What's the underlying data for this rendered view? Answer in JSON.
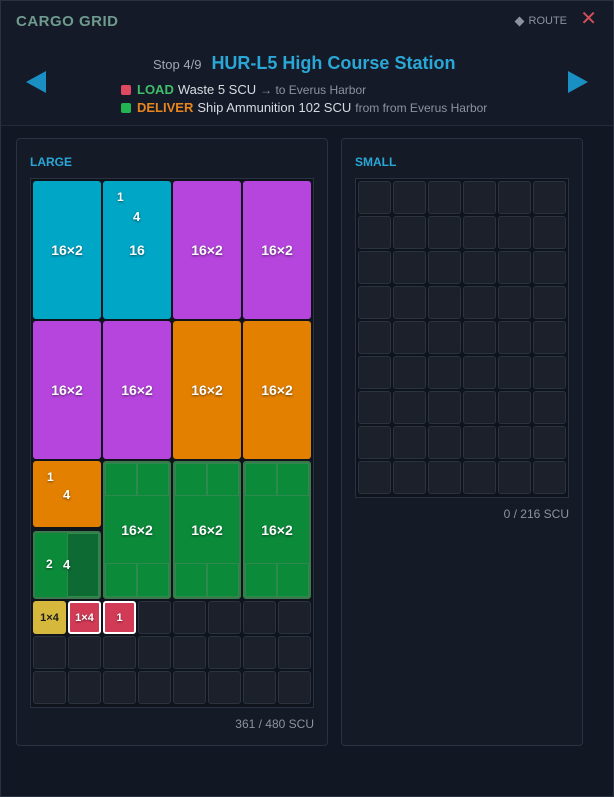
{
  "header": {
    "title": "CARGO GRID",
    "route_label": "ROUTE",
    "close_symbol": "✕",
    "stop_label": "Stop 4/9",
    "station_name": "HUR-L5 High Course Station"
  },
  "tasks": {
    "load": {
      "keyword": "LOAD",
      "cargo": "Waste 5 SCU",
      "dest": "→ to Everus Harbor",
      "color": "#e04a60"
    },
    "deliver": {
      "keyword": "DELIVER",
      "cargo": "Ship Ammunition 102 SCU",
      "dest": "from from Everus Harbor",
      "color": "#23b452"
    }
  },
  "large": {
    "title": "LARGE",
    "capacity": "361 / 480 SCU",
    "blocks": {
      "b1": "16×2",
      "b2_top": "1",
      "b2_mid": "4",
      "b2_main": "16",
      "b3": "16×2",
      "b4": "16×2",
      "b5": "16×2",
      "b6": "16×2",
      "b7": "16×2",
      "b8": "16×2",
      "b9_top": "1",
      "b9_mid": "4",
      "b10": "16×2",
      "b11": "16×2",
      "b12": "16×2",
      "b13_a": "2",
      "b13_b": "4",
      "s1": "1×4",
      "s2": "1×4",
      "s3": "1"
    }
  },
  "small": {
    "title": "SMALL",
    "capacity": "0 / 216 SCU"
  }
}
